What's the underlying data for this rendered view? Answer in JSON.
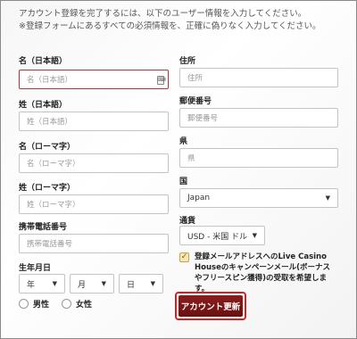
{
  "intro": {
    "line1": "アカウント登録を完了するには、以下のユーザー情報を入力してください。",
    "line2": "※登録フォームにあるすべての必須情報を、正確に偽りなく入力してください。"
  },
  "left": {
    "first_name_jp": {
      "label": "名（日本語）",
      "placeholder": "名（日本語）"
    },
    "last_name_jp": {
      "label": "姓（日本語）",
      "placeholder": "姓（日本語）"
    },
    "first_name_roman": {
      "label": "名（ローマ字）",
      "placeholder": "名（ローマ字）"
    },
    "last_name_roman": {
      "label": "姓（ローマ字）",
      "placeholder": "姓（ローマ字）"
    },
    "mobile": {
      "label": "携帯電話番号",
      "placeholder": "携帯電話番号"
    },
    "birthdate": {
      "label": "生年月日",
      "year": "年",
      "month": "月",
      "day": "日"
    },
    "gender": {
      "male": "男性",
      "female": "女性"
    }
  },
  "right": {
    "address": {
      "label": "住所",
      "placeholder": "住所"
    },
    "postal": {
      "label": "郵便番号",
      "placeholder": "郵便番号"
    },
    "prefecture": {
      "label": "県",
      "placeholder": "県"
    },
    "country": {
      "label": "国",
      "value": "Japan"
    },
    "currency": {
      "label": "通貨",
      "value": "USD - 米国 ドル"
    },
    "opt_in_text": "登録メールアドレスへのLive Casino Houseのキャンペーンメール(ボーナスやフリースピン獲得)の受取を希望します。",
    "opt_in_checked": true
  },
  "submit_label": "アカウント更新",
  "colors": {
    "button": "#7a1414",
    "button_highlight": "#d42020",
    "focus_border": "#a33a3a"
  }
}
